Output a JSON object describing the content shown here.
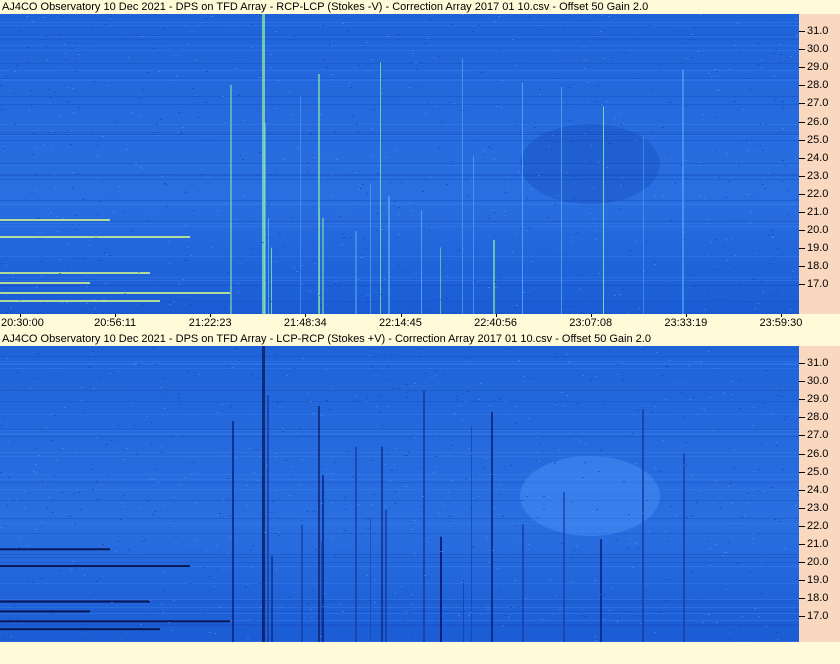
{
  "panels": [
    {
      "title": "AJ4CO Observatory 10 Dec 2021  -  DPS on TFD Array  -  RCP-LCP (Stokes -V)  -  Correction Array 2017 01 10.csv  -  Offset 50  Gain 2.0",
      "polarity": "bright"
    },
    {
      "title": "AJ4CO Observatory 10 Dec 2021  -  DPS on TFD Array  -  LCP-RCP (Stokes +V)  -  Correction Array 2017 01 10.csv  -  Offset 50  Gain 2.0",
      "polarity": "dark"
    }
  ],
  "y_axis_labels": [
    "31.0",
    "30.0",
    "29.0",
    "28.0",
    "27.0",
    "26.0",
    "25.0",
    "24.0",
    "23.0",
    "22.0",
    "21.0",
    "20.0",
    "19.0",
    "18.0",
    "17.0"
  ],
  "x_axis_labels": [
    "20:30:00",
    "20:56:11",
    "21:22:23",
    "21:48:34",
    "22:14:45",
    "22:40:56",
    "23:07:08",
    "23:33:19",
    "23:59:30"
  ],
  "colors": {
    "background": "#fffbd8",
    "axis_panel": "#fad8c0",
    "spectrogram_base": "#1a5fd6",
    "spectrogram_light": "#3d82f0",
    "burst_bright": "#7fe0a0",
    "burst_dark": "#0a1c70"
  }
}
